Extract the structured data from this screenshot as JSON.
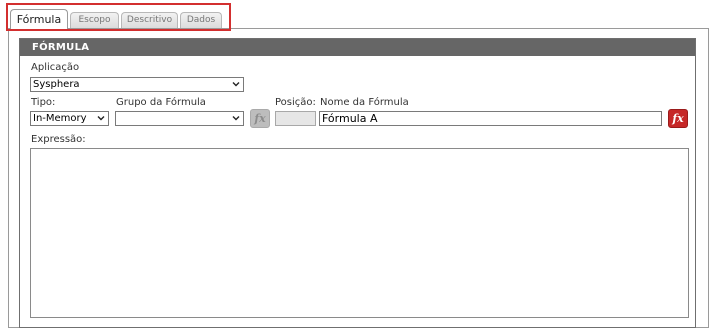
{
  "tabs": [
    {
      "label": "Fórmula",
      "active": true
    },
    {
      "label": "Escopo",
      "active": false
    },
    {
      "label": "Descritivo",
      "active": false
    },
    {
      "label": "Dados",
      "active": false
    }
  ],
  "section": {
    "title": "FÓRMULA"
  },
  "fields": {
    "aplicacao": {
      "label": "Aplicação",
      "value": "Sysphera"
    },
    "tipo": {
      "label": "Tipo:",
      "value": "In-Memory"
    },
    "grupo": {
      "label": "Grupo da Fórmula",
      "value": ""
    },
    "posicao": {
      "label": "Posição:",
      "value": ""
    },
    "nome": {
      "label": "Nome da Fórmula",
      "value": "Fórmula A"
    },
    "expressao": {
      "label": "Expressão:",
      "value": ""
    }
  },
  "buttons": {
    "group_fx_icon": "function-fx-icon",
    "name_fx_icon": "function-fx-icon"
  },
  "colors": {
    "highlight": "#d32f2f",
    "header_bg": "#666666",
    "fx_red": "#c62828"
  }
}
